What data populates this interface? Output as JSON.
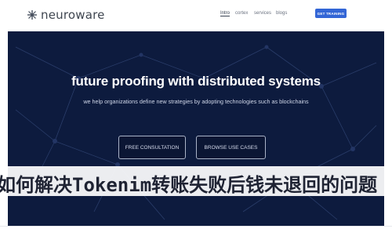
{
  "header": {
    "brand": "neuroware",
    "nav": [
      {
        "label": "Intro",
        "active": true
      },
      {
        "label": "cortex",
        "active": false
      },
      {
        "label": "services",
        "active": false
      },
      {
        "label": "blogs",
        "active": false
      }
    ],
    "cta_label": "GET TRAINING"
  },
  "hero": {
    "title": "future proofing with distributed systems",
    "subtitle": "we help organizations define new strategies by adopting technologies such as blockchains",
    "primary_button": "FREE CONSULTATION",
    "secondary_button": "BROWSE USE CASES"
  },
  "overlay": {
    "title": "如何解决Tokenim转账失败后钱未退回的问题"
  },
  "colors": {
    "hero_bg": "#0d1b3e",
    "cta": "#3366d6",
    "network_lines": "#2a3d6a"
  }
}
